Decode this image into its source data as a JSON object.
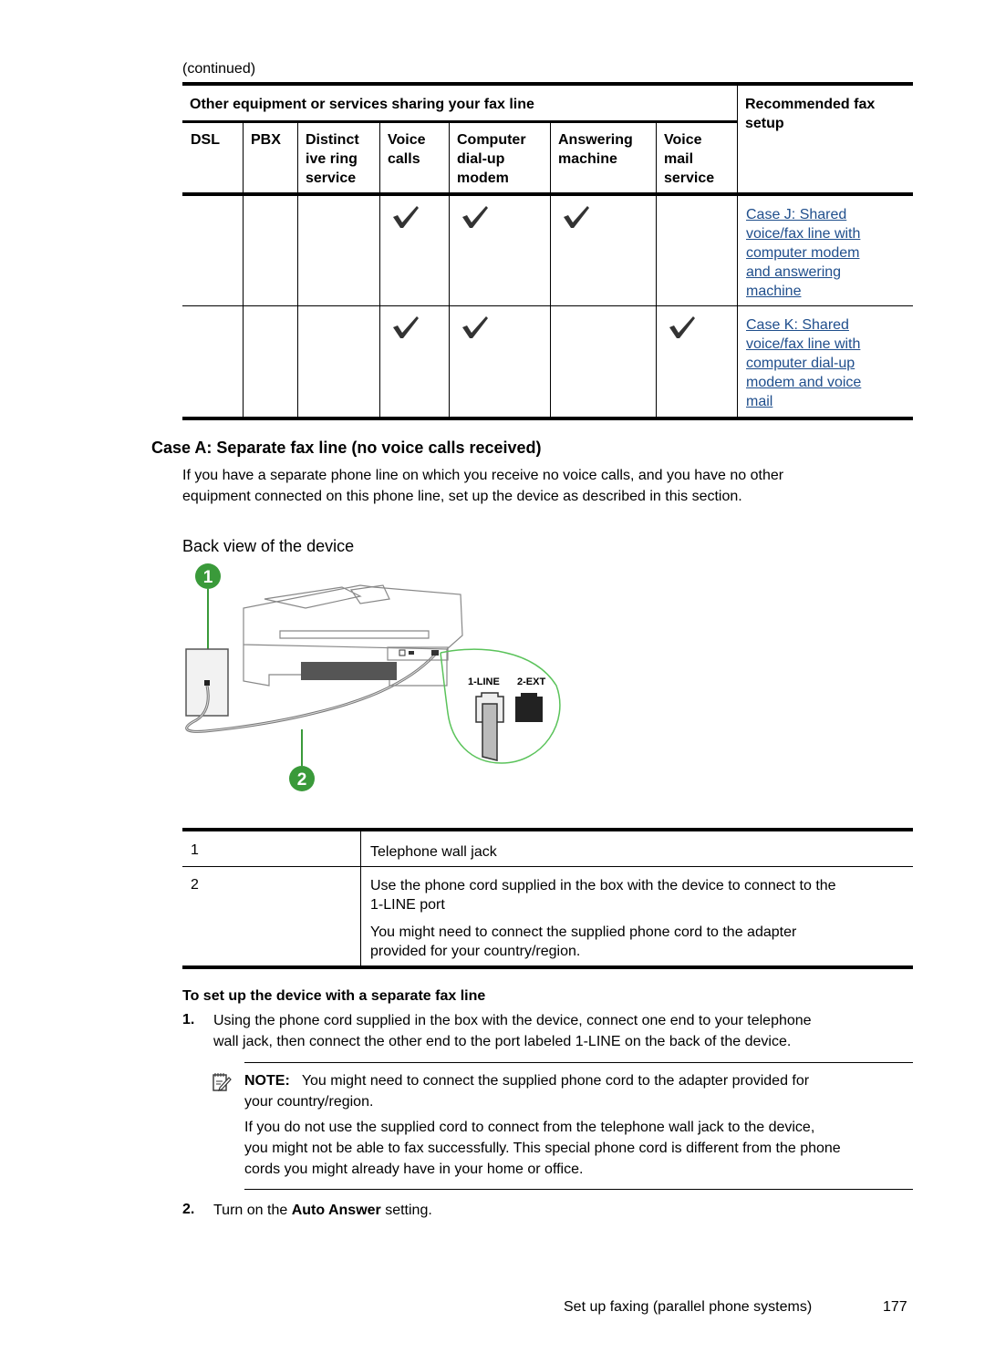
{
  "continued_label": "(continued)",
  "table": {
    "group_header": "Other equipment or services sharing your fax line",
    "recommended_header": "Recommended fax setup",
    "columns": [
      "DSL",
      "PBX",
      "Distinct ive ring service",
      "Voice calls",
      "Computer dial-up modem",
      "Answering machine",
      "Voice mail service"
    ],
    "column_lines": [
      [
        "DSL"
      ],
      [
        "PBX"
      ],
      [
        "Distinct",
        "ive ring",
        "service"
      ],
      [
        "Voice",
        "calls"
      ],
      [
        "Computer",
        "dial-up",
        "modem"
      ],
      [
        "Answering",
        "machine"
      ],
      [
        "Voice",
        "mail",
        "service"
      ]
    ],
    "rows": [
      {
        "checks": [
          false,
          false,
          false,
          true,
          true,
          true,
          false
        ],
        "setup_link": "Case J: Shared voice/fax line with computer modem and answering machine",
        "setup_lines": [
          "Case J: Shared",
          "voice/fax line with",
          "computer modem",
          "and answering",
          "machine"
        ]
      },
      {
        "checks": [
          false,
          false,
          false,
          true,
          true,
          false,
          true
        ],
        "setup_link": "Case K: Shared voice/fax line with computer dial-up modem and voice mail",
        "setup_lines": [
          "Case K: Shared",
          "voice/fax line with",
          "computer dial-up",
          "modem and voice",
          "mail"
        ]
      }
    ]
  },
  "case_a": {
    "title": "Case A: Separate fax line (no voice calls received)",
    "intro_lines": [
      "If you have a separate phone line on which you receive no voice calls, and you have no other",
      "equipment connected on this phone line, set up the device as described in this section."
    ],
    "figure_title": "Back view of the device",
    "diagram": {
      "callouts": [
        "1",
        "2"
      ],
      "port_labels": [
        "1-LINE",
        "2-EXT"
      ],
      "accent_color": "#3a9a3a"
    }
  },
  "legend": [
    {
      "num": "1",
      "lines": [
        "Telephone wall jack"
      ]
    },
    {
      "num": "2",
      "lines": [
        "Use the phone cord supplied in the box with the device to connect to the",
        "1-LINE port"
      ],
      "extra_lines": [
        "You might need to connect the supplied phone cord to the adapter",
        "provided for your country/region."
      ]
    }
  ],
  "procedure": {
    "title": "To set up the device with a separate fax line",
    "step1_num": "1.",
    "step1_lines": [
      "Using the phone cord supplied in the box with the device, connect one end to your telephone",
      "wall jack, then connect the other end to the port labeled 1-LINE on the back of the device."
    ],
    "note_label": "NOTE:",
    "note_line1": "You might need to connect the supplied phone cord to the adapter provided for",
    "note_line2": "your country/region.",
    "note_para_lines": [
      "If you do not use the supplied cord to connect from the telephone wall jack to the device,",
      "you might not be able to fax successfully. This special phone cord is different from the phone",
      "cords you might already have in your home or office."
    ],
    "step2_num": "2.",
    "step2_prefix": "Turn on the ",
    "step2_bold": "Auto Answer",
    "step2_suffix": " setting."
  },
  "footer": {
    "section": "Set up faxing (parallel phone systems)",
    "page": "177"
  }
}
